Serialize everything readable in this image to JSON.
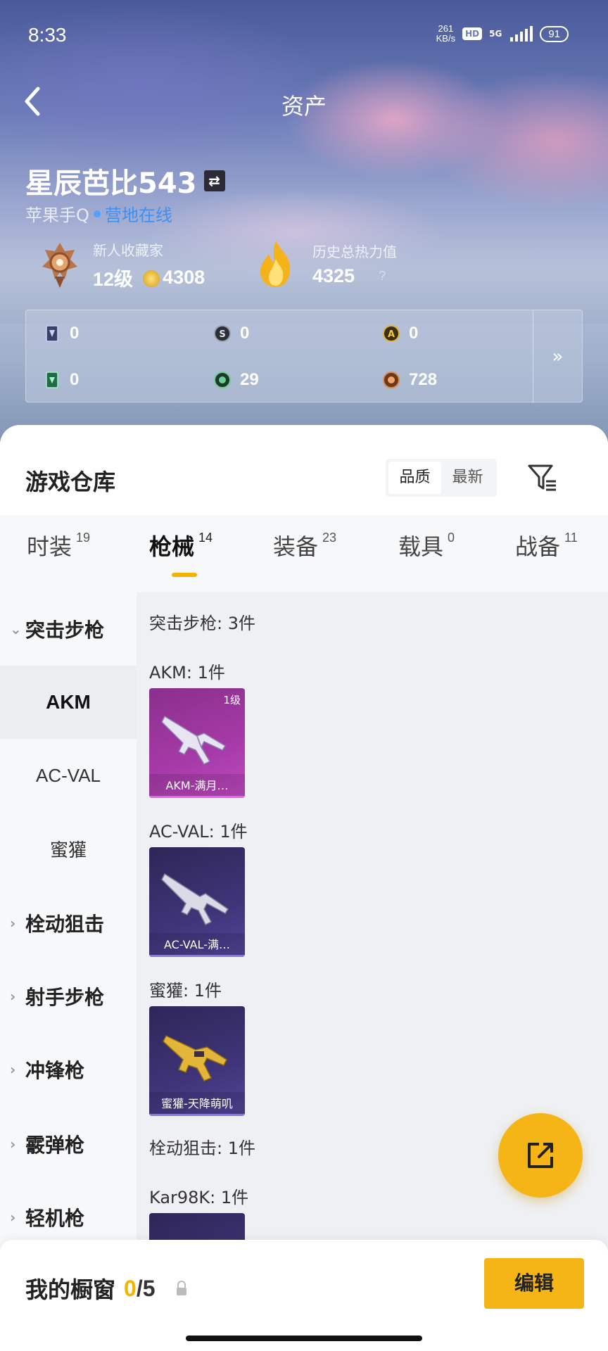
{
  "status_bar": {
    "time": "8:33",
    "net_speed": "261",
    "net_unit": "KB/s",
    "hd": "HD",
    "network": "5G",
    "battery": "91"
  },
  "nav": {
    "title": "资产"
  },
  "profile": {
    "name": "星辰芭比543",
    "platform": "苹果手Q",
    "status": "营地在线",
    "collector_title": "新人收藏家",
    "level": "12级",
    "coins": "4308",
    "heat_label": "历史总热力值",
    "heat_value": "4325",
    "heat_help": "?"
  },
  "currencies": [
    {
      "icon": "card-icon",
      "value": "0"
    },
    {
      "icon": "s-coin-icon",
      "value": "0"
    },
    {
      "icon": "a-coin-icon",
      "value": "0"
    },
    {
      "icon": "green-card-icon",
      "value": "0"
    },
    {
      "icon": "green-gem-icon",
      "value": "29"
    },
    {
      "icon": "bronze-coin-icon",
      "value": "728"
    }
  ],
  "currency_more": "»",
  "warehouse": {
    "title": "游戏仓库",
    "sort_options": [
      "品质",
      "最新"
    ],
    "sort_active": "品质"
  },
  "tabs": [
    {
      "label": "时装",
      "count": "19"
    },
    {
      "label": "枪械",
      "count": "14",
      "active": true
    },
    {
      "label": "装备",
      "count": "23"
    },
    {
      "label": "载具",
      "count": "0"
    },
    {
      "label": "战备",
      "count": "11"
    }
  ],
  "side_menu": [
    {
      "label": "突击步枪",
      "type": "group",
      "expanded": true
    },
    {
      "label": "AKM",
      "type": "sub",
      "selected": true
    },
    {
      "label": "AC-VAL",
      "type": "sub"
    },
    {
      "label": "蜜獾",
      "type": "sub"
    },
    {
      "label": "栓动狙击",
      "type": "group"
    },
    {
      "label": "射手步枪",
      "type": "group"
    },
    {
      "label": "冲锋枪",
      "type": "group"
    },
    {
      "label": "霰弹枪",
      "type": "group"
    },
    {
      "label": "轻机枪",
      "type": "group"
    }
  ],
  "content": {
    "sections": [
      "突击步枪: 3件",
      "AKM: 1件",
      "AC-VAL: 1件",
      "蜜獾: 1件",
      "栓动狙击: 1件",
      "Kar98K: 1件"
    ],
    "items": [
      {
        "name": "AKM-满月…",
        "level": "1级",
        "color": "#c24bc4"
      },
      {
        "name": "AC-VAL-满…",
        "color": "#7b68d0"
      },
      {
        "name": "蜜獾-天降萌叽",
        "color": "#7b68d0"
      }
    ]
  },
  "showcase": {
    "label": "我的橱窗",
    "current": "0",
    "total": "/5",
    "edit": "编辑"
  },
  "colors": {
    "accent": "#f6b516",
    "online": "#3e8ff0"
  }
}
